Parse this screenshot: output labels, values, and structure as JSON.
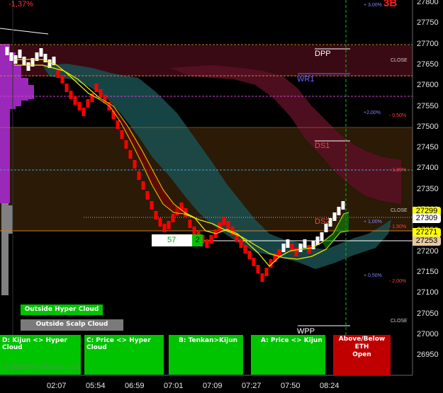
{
  "top_left_change": "-1,37%",
  "top_right_code": "3B",
  "y_ticks": [
    "27800",
    "27750",
    "27700",
    "27650",
    "27600",
    "27550",
    "27500",
    "27450",
    "27400",
    "27350",
    "27300",
    "27250",
    "27200",
    "27150",
    "27100",
    "27050",
    "27000",
    "26950"
  ],
  "x_ticks": [
    "02:07",
    "05:54",
    "06:59",
    "07:01",
    "07:09",
    "07:27",
    "07:50",
    "08:24"
  ],
  "price_labels": {
    "p1": {
      "text": "27299",
      "color": "#ffff00"
    },
    "p2": {
      "text": "27309",
      "color": "#ffffff"
    },
    "p3": {
      "text": "27271",
      "color": "#ffff00"
    },
    "p4": {
      "text": "27253",
      "color": "#e8c8a0"
    }
  },
  "levels": {
    "dpp": "DPP",
    "wr1": "WR1",
    "ds1": "DS1",
    "ds2": "DS2",
    "wpp": "WPP"
  },
  "pct_labels": {
    "p300": "+ 3,00%",
    "close1": "CLOSE",
    "p200": "+2,00%",
    "m050": "- 0,50%",
    "m100": "- 1,00%",
    "close2": "CLOSE",
    "p100": "+ 1,00%",
    "m150": "- 1,50%",
    "p050": "+ 0,50%",
    "m200": "- 2,00%",
    "close3": "CLOSE"
  },
  "counter": {
    "left": "57",
    "right": "2"
  },
  "buttons": {
    "outside_hyper": "Outside Hyper Cloud",
    "outside_scalp": "Outside Scalp Cloud",
    "kijun_hyper": "D: Kijun <> Hyper Cloud",
    "price_hyper": "C: Price <> Hyper Cloud",
    "tenkan_kijun": "B: Tenkan>Kijun",
    "price_kijun": "A: Price <> Kijun",
    "eth_line1": "Above/Below ETH",
    "eth_line2": "Open"
  },
  "copyright": "© 2020 NinjaTrader, LLC",
  "colors": {
    "bull": "#ffffff",
    "bear": "#ff0000",
    "green": "#00c400",
    "dark_red": "#c00000"
  },
  "chart_data": {
    "type": "candlestick",
    "y_range": [
      26925,
      27825
    ],
    "price_levels": {
      "DPP": 27735,
      "WR1": 27665,
      "DS1": 27500,
      "DS2": 27310,
      "WPP": 27040
    }
  }
}
